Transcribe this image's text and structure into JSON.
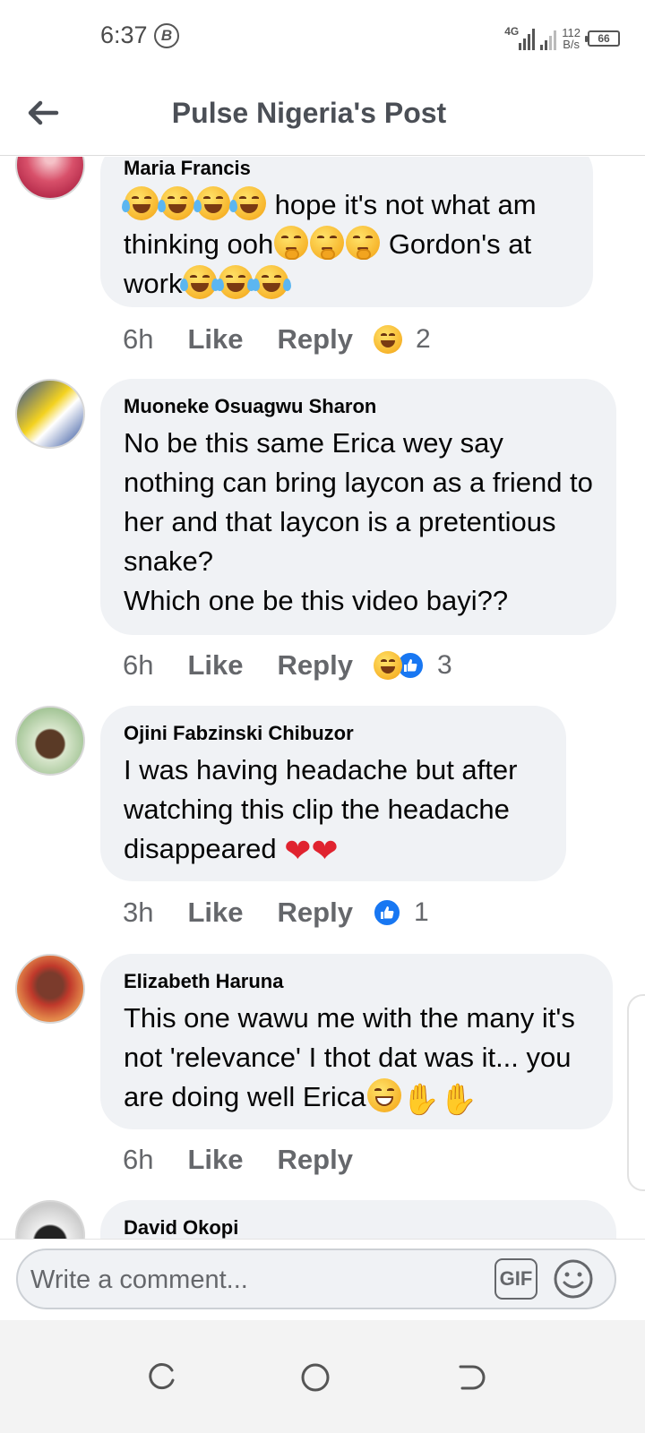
{
  "status_bar": {
    "time": "6:37",
    "network_type": "4G",
    "net_speed_value": "112",
    "net_speed_unit": "B/s",
    "battery": "66"
  },
  "header": {
    "title": "Pulse Nigeria's Post",
    "back_icon": "arrow-left-icon"
  },
  "comments": [
    {
      "author": "Maria Francis",
      "text_segments": [
        "hope it's not what am thinking ooh",
        "Gordon's at work"
      ],
      "time": "6h",
      "like_label": "Like",
      "reply_label": "Reply",
      "reaction_count": "2",
      "reactions": [
        "haha"
      ]
    },
    {
      "author": "Muoneke Osuagwu Sharon",
      "text": "No be this same Erica wey say nothing can bring laycon as a friend to her and that laycon is a pretentious snake?\nWhich one be this video bayi??",
      "time": "6h",
      "like_label": "Like",
      "reply_label": "Reply",
      "reaction_count": "3",
      "reactions": [
        "haha",
        "like"
      ]
    },
    {
      "author": "Ojini Fabzinski Chibuzor",
      "text": "I was having headache but after watching this clip the headache disappeared",
      "time": "3h",
      "like_label": "Like",
      "reply_label": "Reply",
      "reaction_count": "1",
      "reactions": [
        "like"
      ]
    },
    {
      "author": "Elizabeth Haruna",
      "text_segments": [
        "This one wawu me with the many it's not 'relevance' I thot dat was it... you are doing well Erica"
      ],
      "time": "6h",
      "like_label": "Like",
      "reply_label": "Reply"
    },
    {
      "author": "David Okopi"
    }
  ],
  "composer": {
    "placeholder": "Write a comment...",
    "gif_label": "GIF",
    "emoji_icon": "smiley-icon"
  },
  "colors": {
    "bubble": "#f0f2f5",
    "like_blue": "#1877f2",
    "secondary_text": "#65676b",
    "heart_red": "#e0232f"
  }
}
